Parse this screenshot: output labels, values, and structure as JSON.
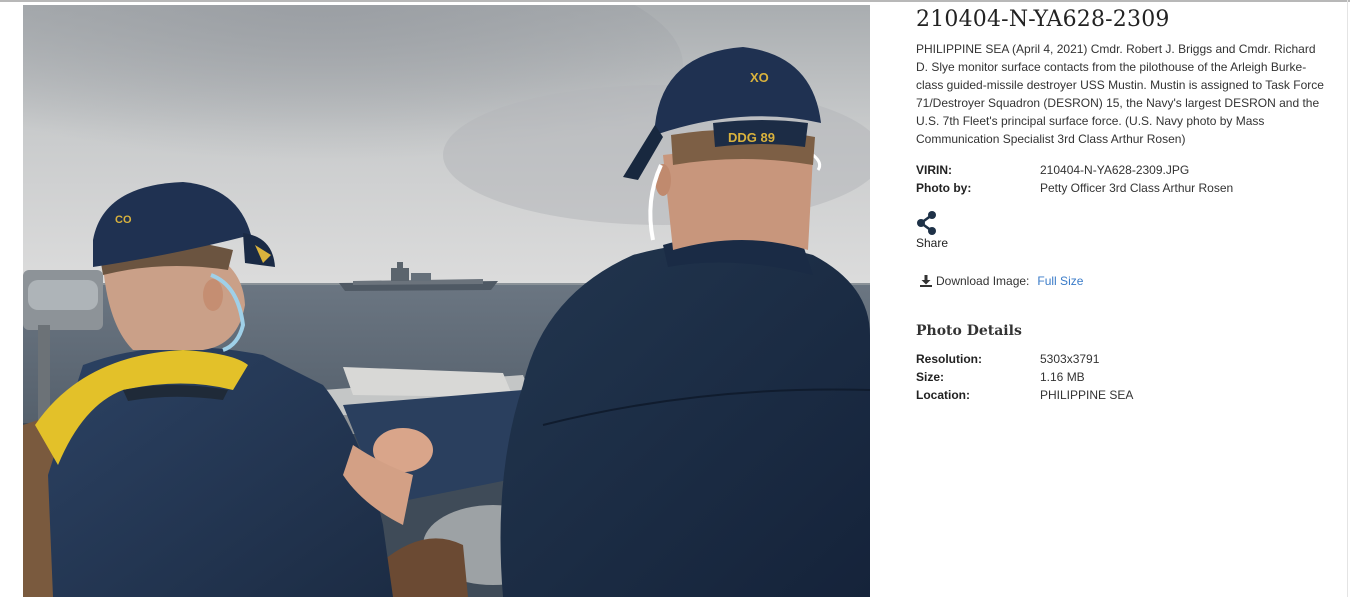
{
  "photo": {
    "alt": "Two officers with CO and XO caps watch an aircraft carrier from a ship's pilothouse",
    "co_cap_text": "CO",
    "xo_cap_text": "XO",
    "ddg_patch_text": "DDG 89"
  },
  "info": {
    "title": "210404-N-YA628-2309",
    "caption": "PHILIPPINE SEA (April 4, 2021) Cmdr. Robert J. Briggs and Cmdr. Richard D. Slye monitor surface contacts from the pilothouse of the Arleigh Burke-class guided-missile destroyer USS Mustin. Mustin is assigned to Task Force 71/Destroyer Squadron (DESRON) 15, the Navy's largest DESRON and the U.S. 7th Fleet's principal surface force. (U.S. Navy photo by Mass Communication Specialist 3rd Class Arthur Rosen)",
    "meta": [
      {
        "label": "VIRIN:",
        "value": "210404-N-YA628-2309.JPG"
      },
      {
        "label": "Photo by:",
        "value": "Petty Officer 3rd Class Arthur Rosen"
      }
    ],
    "share": {
      "icon": "share-icon",
      "label": "Share"
    },
    "download": {
      "icon": "download-icon",
      "label": "Download Image:",
      "link_text": "Full Size"
    },
    "details_heading": "Photo Details",
    "details": [
      {
        "label": "Resolution:",
        "value": "5303x3791"
      },
      {
        "label": "Size:",
        "value": "1.16 MB"
      },
      {
        "label": "Location:",
        "value": "PHILIPPINE SEA"
      }
    ]
  },
  "colors": {
    "link": "#3a7bc8",
    "share_icon": "#1e3147",
    "uniform_navy": "#233448"
  }
}
